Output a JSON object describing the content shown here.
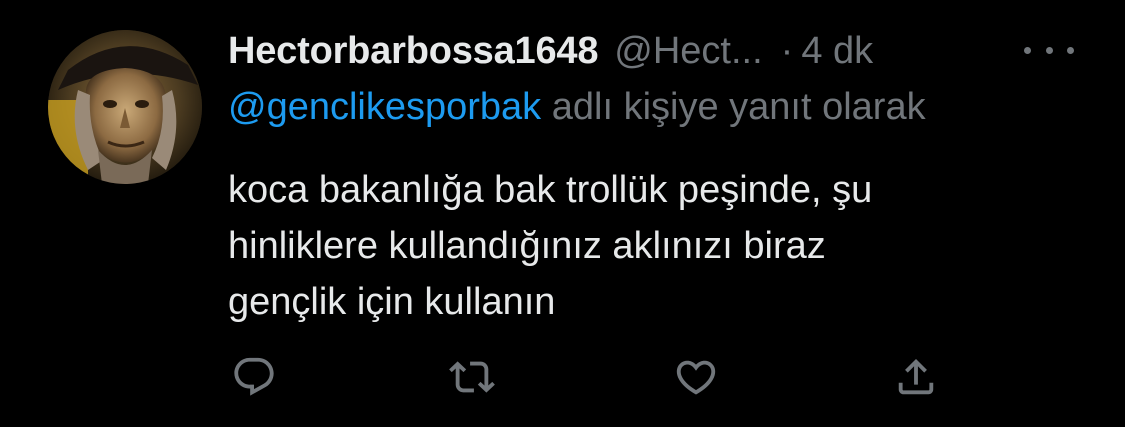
{
  "tweet": {
    "display_name": "Hectorbarbossa1648",
    "handle": "@Hect...",
    "separator": "·",
    "time": "4 dk",
    "reply_to_mention": "@genclikesporbak",
    "reply_suffix": " adlı kişiye yanıt olarak",
    "text_lines": [
      "koca bakanlığa bak trollük peşinde, şu",
      "hinliklere kullandığınız aklınızı biraz",
      "gençlik için kullanın"
    ]
  },
  "icons": {
    "more": "more-horizontal-icon",
    "reply": "reply-icon",
    "retweet": "retweet-icon",
    "like": "heart-icon",
    "share": "share-icon"
  },
  "colors": {
    "background": "#000000",
    "text_primary": "#e7e9ea",
    "text_secondary": "#71767b",
    "accent": "#1d9bf0"
  }
}
